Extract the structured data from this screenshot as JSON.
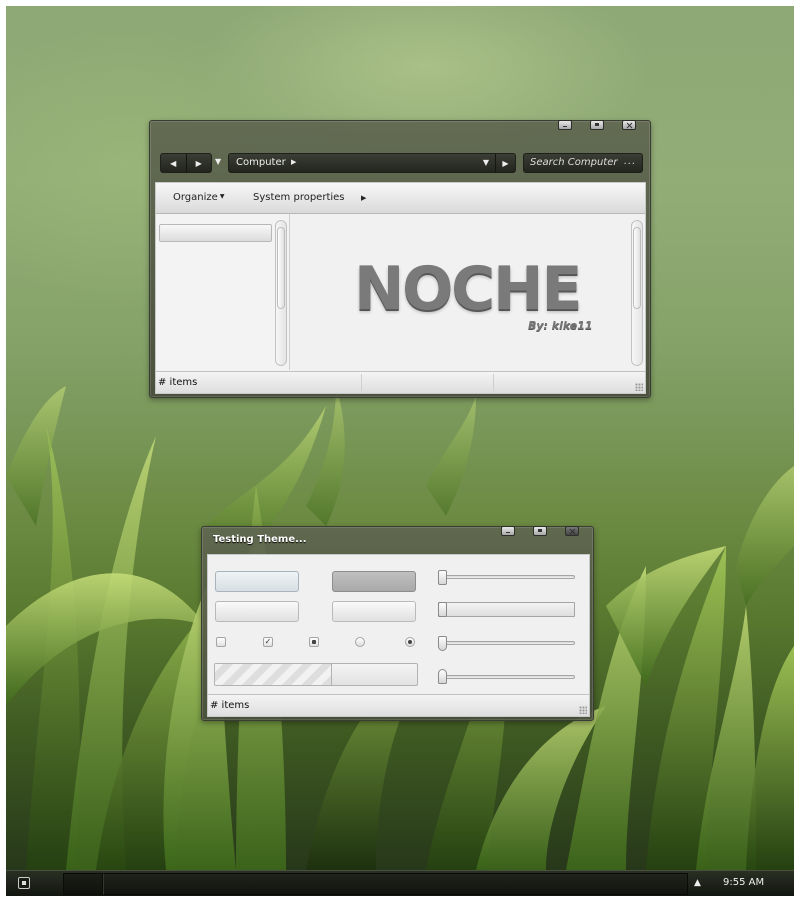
{
  "explorer": {
    "nav": {
      "back_icon": "arrow-left-icon",
      "forward_icon": "arrow-right-icon",
      "history_icon": "chevron-down-icon"
    },
    "address": {
      "text": "Computer"
    },
    "search": {
      "placeholder": "Search Computer",
      "options_label": "..."
    },
    "toolbar": {
      "organize_label": "Organize",
      "system_properties_label": "System properties"
    },
    "logo": {
      "title": "NOCHE",
      "byline": "By: kike11"
    },
    "status": {
      "text": "# items"
    }
  },
  "test_window": {
    "title": "Testing Theme...",
    "status": {
      "text": "# items"
    },
    "progress": 0.58,
    "sliders": [
      0.0,
      0.0,
      0.0,
      0.0
    ],
    "checkboxes": [
      {
        "state": "unchecked"
      },
      {
        "state": "checked"
      },
      {
        "state": "indeterminate"
      }
    ],
    "radios": [
      {
        "state": "off"
      },
      {
        "state": "on"
      }
    ]
  },
  "taskbar": {
    "start_icon": "start-icon",
    "tray_icon": "chevron-up-icon",
    "clock": "9:55 AM"
  },
  "colors": {
    "frame": "#55594a",
    "taskbar": "#1a1d16",
    "logo": "#7a7a7a"
  }
}
